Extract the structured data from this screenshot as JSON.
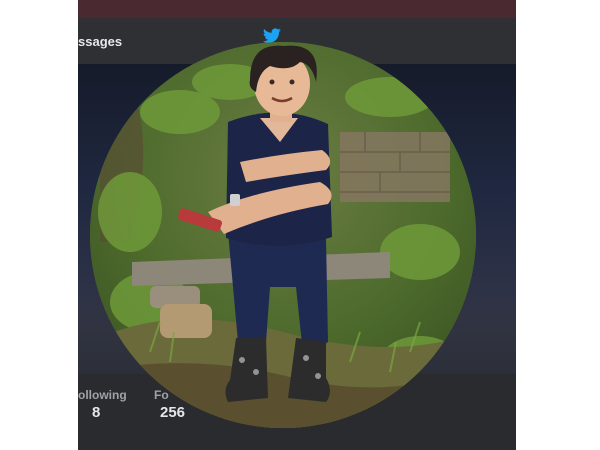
{
  "nav": {
    "messages_label": "ssages"
  },
  "stats": {
    "following_label": "ollowing",
    "following_value": "8",
    "followers_label": "Fo",
    "followers_value": "256"
  },
  "colors": {
    "nav_bg": "#2f3033",
    "accent": "#1da1f2",
    "photo_border": "#ffffff"
  },
  "icons": {
    "brand": "bird-icon"
  }
}
